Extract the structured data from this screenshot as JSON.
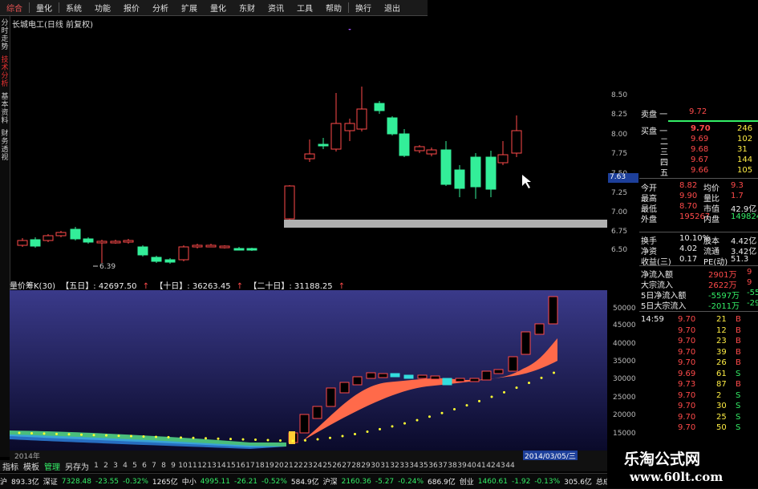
{
  "menu": {
    "items": [
      "综合",
      "量化",
      "系统",
      "功能",
      "报价",
      "分析",
      "扩展",
      "量化",
      "东财",
      "资讯",
      "工具",
      "帮助",
      "换行",
      "退出"
    ]
  },
  "left_tabs": [
    "分时走势",
    "技术分析",
    "基本资料",
    "财务透视"
  ],
  "chart": {
    "title": "长城电工(日线 前复权)",
    "low_label": "6.39",
    "price_ticks": [
      "8.50",
      "8.25",
      "8.00",
      "7.75",
      "7.50",
      "7.25",
      "7.00",
      "6.75",
      "6.50"
    ],
    "current_price_tag": "7.63"
  },
  "quote_panel": {
    "ask_top": {
      "label": "卖盘 一",
      "price": "9.72"
    },
    "bids": [
      {
        "label": "买盘 一",
        "price": "9.70",
        "vol": "246"
      },
      {
        "label": "二",
        "price": "9.69",
        "vol": "102"
      },
      {
        "label": "三",
        "price": "9.68",
        "vol": "31"
      },
      {
        "label": "四",
        "price": "9.67",
        "vol": "144"
      },
      {
        "label": "五",
        "price": "9.66",
        "vol": "105"
      }
    ],
    "stats": [
      {
        "l1": "今开",
        "v1": "8.82",
        "l2": "均价",
        "v2": "9.3"
      },
      {
        "l1": "最高",
        "v1": "9.90",
        "l2": "量比",
        "v2": "1.7"
      },
      {
        "l1": "最低",
        "v1": "8.70",
        "l2": "市值",
        "v2": "42.9亿"
      },
      {
        "l1": "外盘",
        "v1": "195267",
        "l2": "内盘",
        "v2": "149824"
      },
      {
        "l1": "换手",
        "v1": "10.10%",
        "l2": "股本",
        "v2": "4.42亿"
      },
      {
        "l1": "净资",
        "v1": "4.02",
        "l2": "流通",
        "v2": "3.42亿"
      },
      {
        "l1": "收益(三)",
        "v1": "0.17",
        "l2": "PE(动)",
        "v2": "51.3"
      }
    ],
    "flows": [
      {
        "label": "净流入额",
        "v1": "2901万",
        "v2": "9"
      },
      {
        "label": "大宗流入",
        "v1": "2622万",
        "v2": "9"
      },
      {
        "label": "5日净流入额",
        "v1": "-5597万",
        "v2": "-55"
      },
      {
        "label": "5日大宗流入",
        "v1": "-2011万",
        "v2": "-29"
      }
    ],
    "ticks": [
      {
        "time": "14:59",
        "price": "9.70",
        "vol": "21",
        "side": "B"
      },
      {
        "time": "",
        "price": "9.70",
        "vol": "12",
        "side": "B"
      },
      {
        "time": "",
        "price": "9.70",
        "vol": "23",
        "side": "B"
      },
      {
        "time": "",
        "price": "9.70",
        "vol": "39",
        "side": "B"
      },
      {
        "time": "",
        "price": "9.70",
        "vol": "26",
        "side": "B"
      },
      {
        "time": "",
        "price": "9.69",
        "vol": "61",
        "side": "S"
      },
      {
        "time": "",
        "price": "9.73",
        "vol": "87",
        "side": "B"
      },
      {
        "time": "",
        "price": "9.70",
        "vol": "2",
        "side": "S"
      },
      {
        "time": "",
        "price": "9.70",
        "vol": "30",
        "side": "S"
      },
      {
        "time": "",
        "price": "9.70",
        "vol": "25",
        "side": "S"
      },
      {
        "time": "",
        "price": "9.70",
        "vol": "50",
        "side": "S"
      }
    ]
  },
  "lower": {
    "indicator": "量价筹K(30)",
    "five": "【五日】: 42697.50",
    "ten": "【十日】: 36263.45",
    "twenty": "【二十日】: 31188.25",
    "ticks": [
      "50000",
      "45000",
      "40000",
      "35000",
      "30000",
      "25000",
      "20000",
      "15000"
    ]
  },
  "xaxis": {
    "year_label": "2014年",
    "date_tag": "2014/03/05/三"
  },
  "bottom_tabs": {
    "tabs": [
      "指标",
      "模板",
      "管理",
      "另存为"
    ],
    "active": "管理",
    "numbers": [
      "1",
      "2",
      "3",
      "4",
      "5",
      "6",
      "7",
      "8",
      "9",
      "10",
      "11",
      "12",
      "13",
      "14",
      "15",
      "16",
      "17",
      "18",
      "19",
      "20",
      "21",
      "22",
      "23",
      "24",
      "25",
      "26",
      "27",
      "28",
      "29",
      "30",
      "31",
      "32",
      "33",
      "34",
      "35",
      "36",
      "37",
      "38",
      "39",
      "40",
      "41",
      "42",
      "43",
      "44"
    ]
  },
  "status": {
    "items": [
      "沪",
      "893.3亿",
      "深证",
      "7328.48",
      "-23.55",
      "-0.32%",
      "1265亿",
      "中小",
      "4995.11",
      "-26.21",
      "-0.52%",
      "584.9亿",
      "沪深",
      "2160.36",
      "-5.27",
      "-0.24%",
      "686.9亿",
      "创业",
      "1460.61",
      "-1.92",
      "-0.13%",
      "305.6亿",
      "总成交"
    ]
  },
  "watermark": {
    "line1": "乐淘公式网",
    "line2": "www.60lt.com"
  },
  "colors": {
    "up": "#ff4a4a",
    "down": "#33ee99",
    "lower_bg_top": "#3a3a8a",
    "lower_bg_bottom": "#0a0a2a",
    "fill_band": "#ff6a4a",
    "dots": "#ffff33"
  }
}
